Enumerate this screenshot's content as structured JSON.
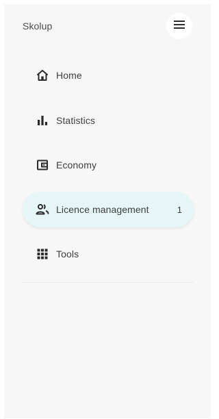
{
  "brand": {
    "name": "Skolup"
  },
  "menu": {
    "icon": "hamburger-menu-icon"
  },
  "nav": {
    "items": [
      {
        "label": "Home",
        "icon": "home-icon",
        "active": false,
        "badge": ""
      },
      {
        "label": "Statistics",
        "icon": "bar-chart-icon",
        "active": false,
        "badge": ""
      },
      {
        "label": "Economy",
        "icon": "wallet-icon",
        "active": false,
        "badge": ""
      },
      {
        "label": "Licence management",
        "icon": "people-icon",
        "active": true,
        "badge": "1"
      },
      {
        "label": "Tools",
        "icon": "grid-apps-icon",
        "active": false,
        "badge": ""
      }
    ]
  },
  "colors": {
    "sidebar_bg": "#f7f7f7",
    "active_bg": "#e6f6f7",
    "text": "#3d3d3d",
    "icon": "#2b2b2b"
  }
}
